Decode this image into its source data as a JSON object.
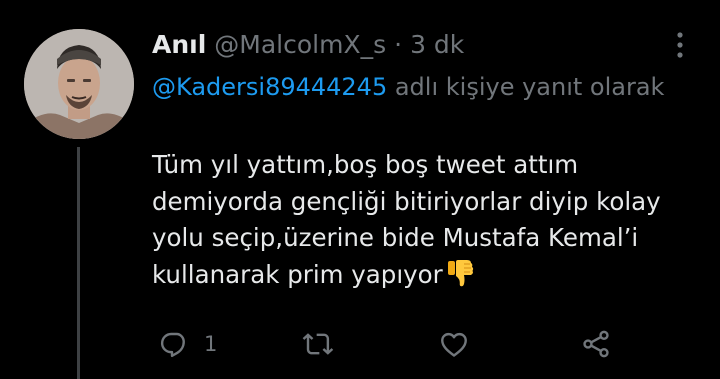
{
  "tweet": {
    "display_name": "Anıl",
    "handle": "@MalcolmX_s",
    "separator": "·",
    "time": "3 dk",
    "reply_mention": "@Kadersi89444245",
    "reply_suffix": " adlı kişiye yanıt olarak",
    "text": "Tüm yıl yattım,boş boş tweet attım demiyorda gençliği bitiriyorlar diyip kolay yolu seçip,üzerine bide Mustafa Kemal’i kullanarak prim yapıyor",
    "reply_count": "1"
  },
  "colors": {
    "background": "#000000",
    "primary_text": "#e7e9ea",
    "secondary_text": "#71767b",
    "accent": "#1d9bf0",
    "thread_line": "#3e4144"
  },
  "icons": {
    "more": "more-vertical-icon",
    "emoji": "thumbs-down-icon",
    "reply": "comment-icon",
    "retweet": "retweet-icon",
    "like": "heart-icon",
    "share": "share-icon"
  }
}
